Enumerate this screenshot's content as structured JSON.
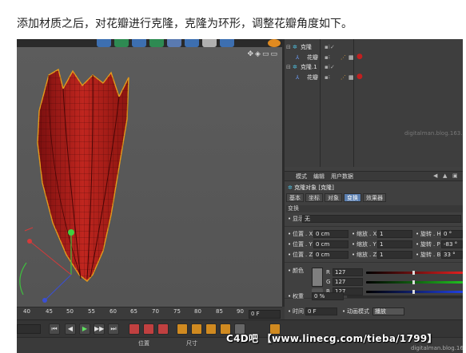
{
  "caption": "添加材质之后，对花瓣进行克隆，克隆为环形，调整花瓣角度如下。",
  "viewport": {
    "nav_icons": "✥◈▭▭"
  },
  "object_manager": {
    "rows": [
      {
        "name": "克隆",
        "indent": 0
      },
      {
        "name": "花瓣",
        "indent": 1
      },
      {
        "name": "克隆.1",
        "indent": 0
      },
      {
        "name": "花瓣",
        "indent": 1
      }
    ],
    "faint_text": "digitalman.blog.163.com"
  },
  "attribute_manager": {
    "menu": [
      "模式",
      "编辑",
      "用户数据"
    ],
    "title": "克隆对象 [克隆]",
    "tabs": [
      "基本",
      "坐标",
      "对象",
      "变换",
      "效果器"
    ],
    "active_tab": "变换",
    "section": "变换",
    "display_label": "显示",
    "display_value": "无",
    "position": {
      "label": "位置",
      "x": "0 cm",
      "y": "0 cm",
      "z": "0 cm"
    },
    "scale": {
      "label": "缩放",
      "x": "1",
      "y": "1",
      "z": "1"
    },
    "rotation": {
      "label": "旋转",
      "h": "0 °",
      "p": "-83 °",
      "b": "33 °"
    },
    "color": {
      "label": "颜色",
      "r": "127",
      "g": "127",
      "b": "127"
    },
    "weight": {
      "label": "权重",
      "value": "0 %"
    },
    "time": {
      "label": "时间",
      "value": "0 F"
    },
    "anim_mode": {
      "label": "动画模式",
      "value": "播放"
    }
  },
  "timeline": {
    "ticks": [
      "40",
      "45",
      "50",
      "55",
      "60",
      "65",
      "70",
      "75",
      "80",
      "85",
      "90"
    ],
    "current_frame": "0 F"
  },
  "transport": {
    "buttons": [
      "⏮",
      "◀",
      "▶",
      "▶▶",
      "⏭"
    ]
  },
  "bottom": {
    "col1": "位置",
    "col2": "尺寸"
  },
  "watermark": {
    "main": "C4D吧 【www.linecg.com/tieba/1799】",
    "small": "digitalman.blog.163.com"
  }
}
